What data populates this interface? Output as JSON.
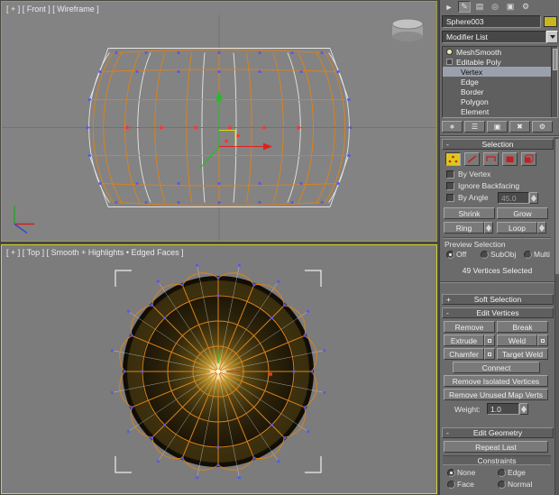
{
  "colors": {
    "object_color": "#c8b81e",
    "active_viewport_border": "#d4d42e",
    "wireframe_orange": "#d9821e",
    "selection_red": "#ff3232",
    "vertex_blue": "#5858e8",
    "subobject_active_bg": "#ddc71c"
  },
  "viewports": {
    "front": {
      "label": "[ + ] [ Front ] [ Wireframe ]"
    },
    "top": {
      "label": "[ + ] [ Top ] [ Smooth + Highlights • Edged Faces ]"
    }
  },
  "panel": {
    "tabs": [
      {
        "name": "create",
        "glyph": "►"
      },
      {
        "name": "modify",
        "glyph": "✎"
      },
      {
        "name": "hierarchy",
        "glyph": "▤"
      },
      {
        "name": "motion",
        "glyph": "◎"
      },
      {
        "name": "display",
        "glyph": "▣"
      },
      {
        "name": "utilities",
        "glyph": "⚙"
      }
    ],
    "object_name": "Sphere003",
    "modifier_list": "Modifier List",
    "stack": {
      "items": [
        {
          "label": "MeshSmooth"
        },
        {
          "label": "Editable Poly"
        },
        {
          "label": "Vertex",
          "selected": true
        },
        {
          "label": "Edge"
        },
        {
          "label": "Border"
        },
        {
          "label": "Polygon"
        },
        {
          "label": "Element"
        }
      ]
    },
    "stack_tools": [
      {
        "name": "pin-stack",
        "glyph": "∗"
      },
      {
        "name": "show-end-result",
        "glyph": "☰"
      },
      {
        "name": "make-unique",
        "glyph": "▣"
      },
      {
        "name": "remove-modifier",
        "glyph": "✖"
      },
      {
        "name": "configure-modifier-sets",
        "glyph": "⚙"
      }
    ],
    "selection": {
      "title": "Selection",
      "collapse_sign": "-",
      "by_vertex": "By Vertex",
      "ignore_backfacing": "Ignore Backfacing",
      "by_angle": "By Angle",
      "by_angle_value": "45.0",
      "shrink": "Shrink",
      "grow": "Grow",
      "ring": "Ring",
      "loop": "Loop",
      "preview_label": "Preview Selection",
      "preview_options": [
        {
          "label": "Off",
          "selected": true
        },
        {
          "label": "SubObj",
          "selected": false
        },
        {
          "label": "Multi",
          "selected": false
        }
      ],
      "status": "49 Vertices Selected"
    },
    "soft_selection": {
      "title": "Soft Selection",
      "collapse_sign": "+"
    },
    "edit_vertices": {
      "title": "Edit Vertices",
      "collapse_sign": "-",
      "remove": "Remove",
      "break": "Break",
      "extrude": "Extrude",
      "weld": "Weld",
      "chamfer": "Chamfer",
      "target_weld": "Target Weld",
      "connect": "Connect",
      "remove_isolated": "Remove Isolated Vertices",
      "remove_unused": "Remove Unused Map Verts",
      "weight_label": "Weight:",
      "weight_value": "1.0"
    },
    "edit_geometry": {
      "title": "Edit Geometry",
      "collapse_sign": "-",
      "repeat_last": "Repeat Last",
      "constraints_label": "Constraints",
      "constraint_options": [
        {
          "label": "None",
          "selected": true
        },
        {
          "label": "Edge",
          "selected": false
        },
        {
          "label": "Face",
          "selected": false
        },
        {
          "label": "Normal",
          "selected": false
        }
      ]
    }
  }
}
